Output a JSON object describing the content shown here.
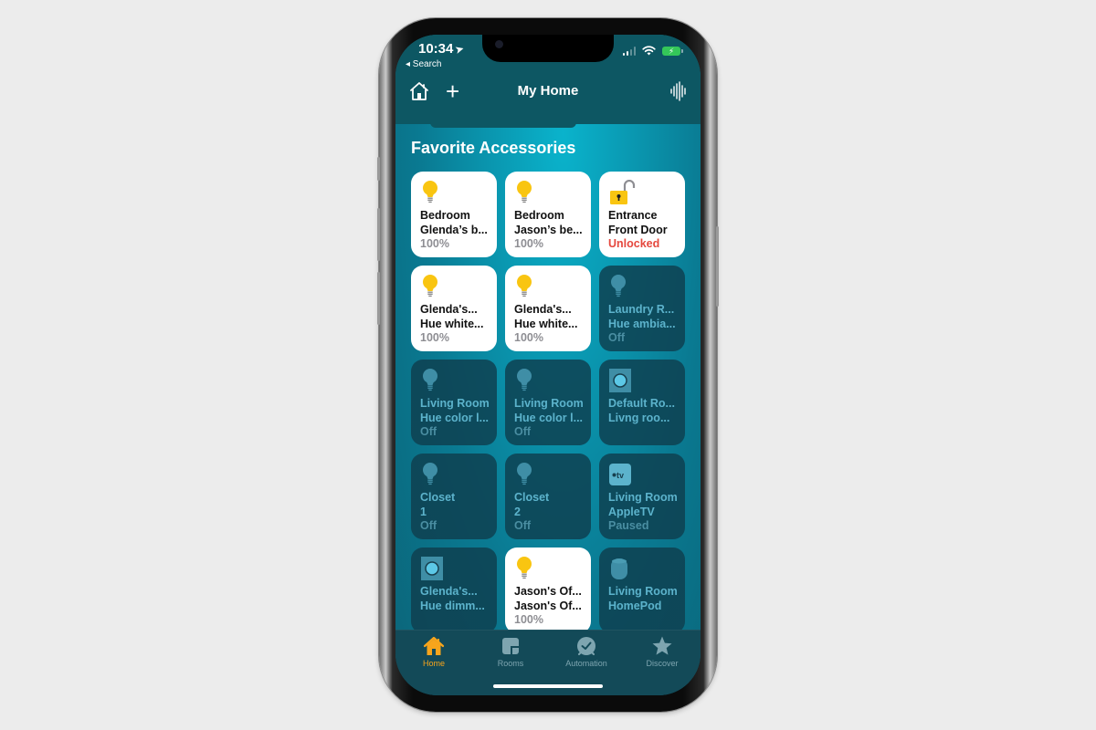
{
  "status_bar": {
    "time": "10:34",
    "back_label": "◂ Search",
    "signal_bars_active": 2,
    "signal_bars_total": 4,
    "battery_charging": true
  },
  "nav": {
    "title": "My Home",
    "home_icon": "home-icon",
    "add_icon": "plus-icon",
    "siri_icon": "waveform-icon"
  },
  "section": {
    "title": "Favorite Accessories"
  },
  "accessories": [
    {
      "icon": "lightbulb",
      "state": "on",
      "line1": "Bedroom",
      "line2": "Glenda’s b...",
      "status": "100%"
    },
    {
      "icon": "lightbulb",
      "state": "on",
      "line1": "Bedroom",
      "line2": "Jason’s be...",
      "status": "100%"
    },
    {
      "icon": "lock-open",
      "state": "on",
      "line1": "Entrance",
      "line2": "Front Door",
      "status": "Unlocked",
      "status_alert": true
    },
    {
      "icon": "lightbulb",
      "state": "on",
      "line1": "Glenda's...",
      "line2": "Hue white...",
      "status": "100%"
    },
    {
      "icon": "lightbulb",
      "state": "on",
      "line1": "Glenda's...",
      "line2": "Hue white...",
      "status": "100%"
    },
    {
      "icon": "lightbulb",
      "state": "off",
      "line1": "Laundry R...",
      "line2": "Hue ambia...",
      "status": "Off"
    },
    {
      "icon": "lightbulb",
      "state": "off",
      "line1": "Living Room",
      "line2": "Hue color l...",
      "status": "Off"
    },
    {
      "icon": "lightbulb",
      "state": "off",
      "line1": "Living Room",
      "line2": "Hue color l...",
      "status": "Off"
    },
    {
      "icon": "switch",
      "state": "off",
      "line1": "Default Ro...",
      "line2": "Livng roo...",
      "status": ""
    },
    {
      "icon": "lightbulb",
      "state": "off",
      "line1": "Closet",
      "line2": "1",
      "status": "Off"
    },
    {
      "icon": "lightbulb",
      "state": "off",
      "line1": "Closet",
      "line2": "2",
      "status": "Off"
    },
    {
      "icon": "appletv",
      "state": "off",
      "line1": "Living Room",
      "line2": "AppleTV",
      "status": "Paused"
    },
    {
      "icon": "switch",
      "state": "off",
      "line1": "Glenda's...",
      "line2": "Hue dimm...",
      "status": ""
    },
    {
      "icon": "lightbulb",
      "state": "on",
      "line1": "Jason's Of...",
      "line2": "Jason's Of...",
      "status": "100%"
    },
    {
      "icon": "homepod",
      "state": "off",
      "line1": "Living Room",
      "line2": "HomePod",
      "status": ""
    }
  ],
  "tabbar": {
    "tabs": [
      {
        "label": "Home",
        "icon": "home-icon",
        "active": true
      },
      {
        "label": "Rooms",
        "icon": "rooms-icon",
        "active": false
      },
      {
        "label": "Automation",
        "icon": "automation-icon",
        "active": false
      },
      {
        "label": "Discover",
        "icon": "star-icon",
        "active": false
      }
    ]
  },
  "colors": {
    "accent": "#f7a51c",
    "bulb_on": "#f9c511",
    "alert": "#e5483e",
    "off_text": "#5cb3cc"
  }
}
